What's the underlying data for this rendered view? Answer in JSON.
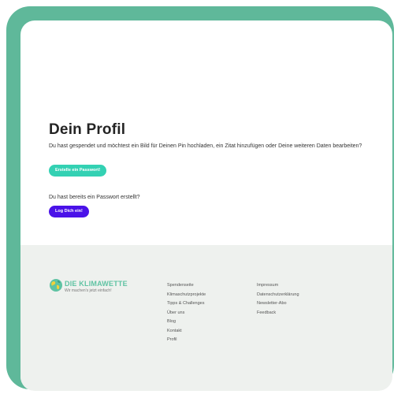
{
  "profile": {
    "title": "Dein Profil",
    "intro": "Du hast gespendet und möchtest ein Bild für Deinen Pin hochladen, ein Zitat hinzufügen oder Deine weiteren Daten bearbeiten?",
    "create_password_label": "Erstelle ein Passwort!",
    "login_prompt": "Du hast bereits ein Passwort erstellt?",
    "login_label": "Log Dich ein!"
  },
  "footer": {
    "logo": {
      "name": "DIE KLIMAWETTE",
      "tagline": "Wir machen's jetzt einfach!"
    },
    "links_col1": [
      "Spendenseite",
      "Klimaschutzprojekte",
      "Tipps & Challenges",
      "Über uns",
      "Blog",
      "Kontakt",
      "Profil"
    ],
    "links_col2": [
      "Impressum",
      "Datenschutzerklärung",
      "Newsletter-Abo",
      "Feedback"
    ]
  },
  "colors": {
    "frame": "#5fb89a",
    "create_button": "#33d1b3",
    "login_button": "#4a12e8",
    "footer_bg": "#eef1ee",
    "logo_text": "#5fc3a3"
  }
}
